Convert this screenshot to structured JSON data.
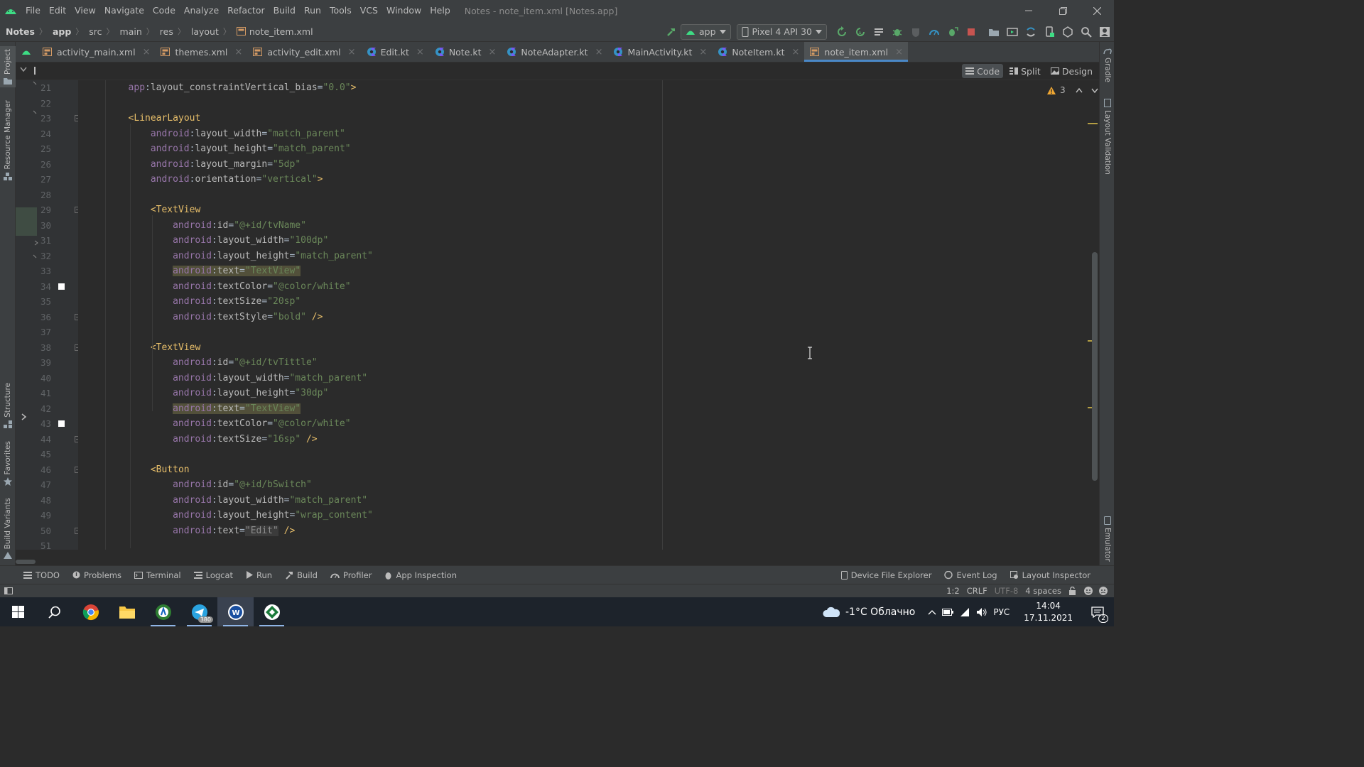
{
  "window": {
    "title": "Notes - note_item.xml [Notes.app]",
    "menu": [
      "File",
      "Edit",
      "View",
      "Navigate",
      "Code",
      "Analyze",
      "Refactor",
      "Build",
      "Run",
      "Tools",
      "VCS",
      "Window",
      "Help"
    ]
  },
  "breadcrumb": [
    "Notes",
    "app",
    "src",
    "main",
    "res",
    "layout",
    "note_item.xml"
  ],
  "toolbar": {
    "run_config": "app",
    "device": "Pixel 4 API 30"
  },
  "left_tools": [
    "Project",
    "Resource Manager",
    "Structure",
    "Favorites",
    "Build Variants"
  ],
  "right_tools": [
    "Gradle",
    "Layout Validation",
    "Emulator"
  ],
  "tabs": [
    {
      "label": "activity_main.xml",
      "type": "xml",
      "active": false
    },
    {
      "label": "themes.xml",
      "type": "xml",
      "active": false
    },
    {
      "label": "activity_edit.xml",
      "type": "xml",
      "active": false
    },
    {
      "label": "Edit.kt",
      "type": "kt",
      "active": false
    },
    {
      "label": "Note.kt",
      "type": "kt",
      "active": false
    },
    {
      "label": "NoteAdapter.kt",
      "type": "kt",
      "active": false
    },
    {
      "label": "MainActivity.kt",
      "type": "kt",
      "active": false
    },
    {
      "label": "NoteItem.kt",
      "type": "kt",
      "active": false
    },
    {
      "label": "note_item.xml",
      "type": "xml",
      "active": true
    }
  ],
  "view_modes": {
    "code": "Code",
    "split": "Split",
    "design": "Design",
    "selected": "Code"
  },
  "inspections": {
    "warnings": "3"
  },
  "editor": {
    "lines": [
      {
        "n": "21",
        "indent": 2,
        "tokens": [
          [
            "ns",
            "app"
          ],
          [
            "eq",
            ":"
          ],
          [
            "attr",
            "layout_constraintVertical_bias"
          ],
          [
            "eq",
            "="
          ],
          [
            "str",
            "\"0.0\""
          ],
          [
            "tag",
            ">"
          ]
        ]
      },
      {
        "n": "22",
        "indent": 0,
        "tokens": []
      },
      {
        "n": "23",
        "indent": 2,
        "fold": true,
        "tokens": [
          [
            "tag",
            "<LinearLayout"
          ]
        ]
      },
      {
        "n": "24",
        "indent": 3,
        "tokens": [
          [
            "ns",
            "android"
          ],
          [
            "eq",
            ":"
          ],
          [
            "attr",
            "layout_width"
          ],
          [
            "eq",
            "="
          ],
          [
            "str",
            "\"match_parent\""
          ]
        ]
      },
      {
        "n": "25",
        "indent": 3,
        "tokens": [
          [
            "ns",
            "android"
          ],
          [
            "eq",
            ":"
          ],
          [
            "attr",
            "layout_height"
          ],
          [
            "eq",
            "="
          ],
          [
            "str",
            "\"match_parent\""
          ]
        ]
      },
      {
        "n": "26",
        "indent": 3,
        "tokens": [
          [
            "ns",
            "android"
          ],
          [
            "eq",
            ":"
          ],
          [
            "attr",
            "layout_margin"
          ],
          [
            "eq",
            "="
          ],
          [
            "str",
            "\"5dp\""
          ]
        ]
      },
      {
        "n": "27",
        "indent": 3,
        "tokens": [
          [
            "ns",
            "android"
          ],
          [
            "eq",
            ":"
          ],
          [
            "attr",
            "orientation"
          ],
          [
            "eq",
            "="
          ],
          [
            "str",
            "\"vertical\""
          ],
          [
            "tag",
            ">"
          ]
        ]
      },
      {
        "n": "28",
        "indent": 0,
        "tokens": []
      },
      {
        "n": "29",
        "indent": 3,
        "fold": true,
        "tokens": [
          [
            "tag",
            "<TextView"
          ]
        ]
      },
      {
        "n": "30",
        "indent": 4,
        "tokens": [
          [
            "ns",
            "android"
          ],
          [
            "eq",
            ":"
          ],
          [
            "attr",
            "id"
          ],
          [
            "eq",
            "="
          ],
          [
            "str",
            "\"@+id/tvName\""
          ]
        ]
      },
      {
        "n": "31",
        "indent": 4,
        "tokens": [
          [
            "ns",
            "android"
          ],
          [
            "eq",
            ":"
          ],
          [
            "attr",
            "layout_width"
          ],
          [
            "eq",
            "="
          ],
          [
            "str",
            "\"100dp\""
          ]
        ]
      },
      {
        "n": "32",
        "indent": 4,
        "tokens": [
          [
            "ns",
            "android"
          ],
          [
            "eq",
            ":"
          ],
          [
            "attr",
            "layout_height"
          ],
          [
            "eq",
            "="
          ],
          [
            "str",
            "\"match_parent\""
          ]
        ]
      },
      {
        "n": "33",
        "indent": 4,
        "highlight": true,
        "tokens": [
          [
            "ns",
            "android"
          ],
          [
            "eq",
            ":"
          ],
          [
            "attr",
            "text"
          ],
          [
            "eq",
            "="
          ],
          [
            "str",
            "\"TextView\""
          ]
        ]
      },
      {
        "n": "34",
        "indent": 4,
        "swatch": "#ffffff",
        "tokens": [
          [
            "ns",
            "android"
          ],
          [
            "eq",
            ":"
          ],
          [
            "attr",
            "textColor"
          ],
          [
            "eq",
            "="
          ],
          [
            "str",
            "\"@color/white\""
          ]
        ]
      },
      {
        "n": "35",
        "indent": 4,
        "tokens": [
          [
            "ns",
            "android"
          ],
          [
            "eq",
            ":"
          ],
          [
            "attr",
            "textSize"
          ],
          [
            "eq",
            "="
          ],
          [
            "str",
            "\"20sp\""
          ]
        ]
      },
      {
        "n": "36",
        "indent": 4,
        "fold": true,
        "tokens": [
          [
            "ns",
            "android"
          ],
          [
            "eq",
            ":"
          ],
          [
            "attr",
            "textStyle"
          ],
          [
            "eq",
            "="
          ],
          [
            "str",
            "\"bold\""
          ],
          [
            "tag",
            " />"
          ]
        ]
      },
      {
        "n": "37",
        "indent": 0,
        "tokens": []
      },
      {
        "n": "38",
        "indent": 3,
        "fold": true,
        "tokens": [
          [
            "tag",
            "<TextView"
          ]
        ]
      },
      {
        "n": "39",
        "indent": 4,
        "tokens": [
          [
            "ns",
            "android"
          ],
          [
            "eq",
            ":"
          ],
          [
            "attr",
            "id"
          ],
          [
            "eq",
            "="
          ],
          [
            "str",
            "\"@+id/tvTittle\""
          ]
        ]
      },
      {
        "n": "40",
        "indent": 4,
        "tokens": [
          [
            "ns",
            "android"
          ],
          [
            "eq",
            ":"
          ],
          [
            "attr",
            "layout_width"
          ],
          [
            "eq",
            "="
          ],
          [
            "str",
            "\"match_parent\""
          ]
        ]
      },
      {
        "n": "41",
        "indent": 4,
        "tokens": [
          [
            "ns",
            "android"
          ],
          [
            "eq",
            ":"
          ],
          [
            "attr",
            "layout_height"
          ],
          [
            "eq",
            "="
          ],
          [
            "str",
            "\"30dp\""
          ]
        ]
      },
      {
        "n": "42",
        "indent": 4,
        "highlight": true,
        "tokens": [
          [
            "ns",
            "android"
          ],
          [
            "eq",
            ":"
          ],
          [
            "attr",
            "text"
          ],
          [
            "eq",
            "="
          ],
          [
            "str",
            "\"TextView\""
          ]
        ]
      },
      {
        "n": "43",
        "indent": 4,
        "swatch": "#ffffff",
        "tokens": [
          [
            "ns",
            "android"
          ],
          [
            "eq",
            ":"
          ],
          [
            "attr",
            "textColor"
          ],
          [
            "eq",
            "="
          ],
          [
            "str",
            "\"@color/white\""
          ]
        ]
      },
      {
        "n": "44",
        "indent": 4,
        "fold": true,
        "tokens": [
          [
            "ns",
            "android"
          ],
          [
            "eq",
            ":"
          ],
          [
            "attr",
            "textSize"
          ],
          [
            "eq",
            "="
          ],
          [
            "str",
            "\"16sp\""
          ],
          [
            "tag",
            " />"
          ]
        ]
      },
      {
        "n": "45",
        "indent": 0,
        "tokens": []
      },
      {
        "n": "46",
        "indent": 3,
        "fold": true,
        "tokens": [
          [
            "tag",
            "<Button"
          ]
        ]
      },
      {
        "n": "47",
        "indent": 4,
        "tokens": [
          [
            "ns",
            "android"
          ],
          [
            "eq",
            ":"
          ],
          [
            "attr",
            "id"
          ],
          [
            "eq",
            "="
          ],
          [
            "str",
            "\"@+id/bSwitch\""
          ]
        ]
      },
      {
        "n": "48",
        "indent": 4,
        "tokens": [
          [
            "ns",
            "android"
          ],
          [
            "eq",
            ":"
          ],
          [
            "attr",
            "layout_width"
          ],
          [
            "eq",
            "="
          ],
          [
            "str",
            "\"match_parent\""
          ]
        ]
      },
      {
        "n": "49",
        "indent": 4,
        "tokens": [
          [
            "ns",
            "android"
          ],
          [
            "eq",
            ":"
          ],
          [
            "attr",
            "layout_height"
          ],
          [
            "eq",
            "="
          ],
          [
            "str",
            "\"wrap_content\""
          ]
        ]
      },
      {
        "n": "50",
        "indent": 4,
        "fold": true,
        "tokens": [
          [
            "ns",
            "android"
          ],
          [
            "eq",
            ":"
          ],
          [
            "attr",
            "text"
          ],
          [
            "eq",
            "="
          ],
          [
            "strbox",
            "\"Edit\""
          ],
          [
            "tag",
            " />"
          ]
        ]
      },
      {
        "n": "51",
        "indent": 0,
        "tokens": []
      }
    ]
  },
  "tool_windows_left": [
    "TODO",
    "Problems",
    "Terminal",
    "Logcat",
    "Run",
    "Build",
    "Profiler",
    "App Inspection"
  ],
  "tool_windows_right": [
    "Device File Explorer",
    "Event Log",
    "Layout Inspector"
  ],
  "status": {
    "position": "1:2",
    "line_sep": "CRLF",
    "encoding": "UTF-8",
    "indent": "4 spaces"
  },
  "taskbar": {
    "weather": "-1°C Облачно",
    "lang": "РУС",
    "time": "14:04",
    "date": "17.11.2021",
    "notifications": "2",
    "telegram_badge": "380"
  },
  "colors": {
    "accent": "#4a88c7",
    "android_green": "#3ddc84"
  }
}
